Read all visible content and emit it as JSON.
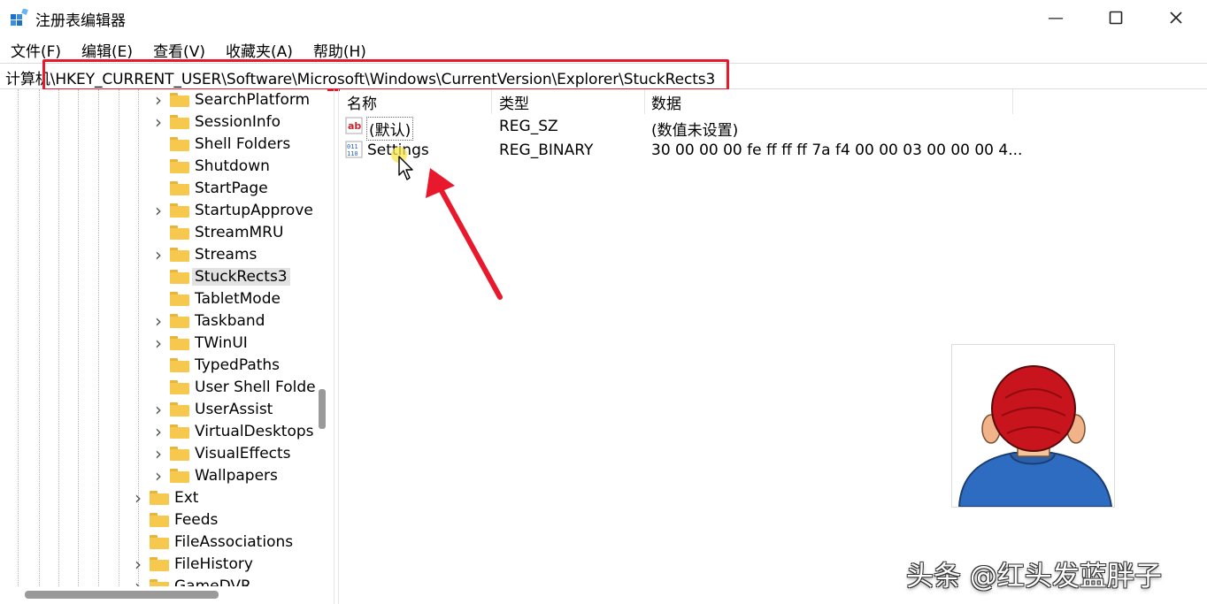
{
  "window": {
    "title": "注册表编辑器",
    "minimize_glyph": "—",
    "maximize_glyph": "☐",
    "close_glyph": "✕"
  },
  "menu": [
    "文件(F)",
    "编辑(E)",
    "查看(V)",
    "收藏夹(A)",
    "帮助(H)"
  ],
  "address": {
    "path": "计算机\\HKEY_CURRENT_USER\\Software\\Microsoft\\Windows\\CurrentVersion\\Explorer\\StuckRects3"
  },
  "tree": {
    "items": [
      {
        "label": "SearchPlatform",
        "expandable": true
      },
      {
        "label": "SessionInfo",
        "expandable": true
      },
      {
        "label": "Shell Folders",
        "expandable": false
      },
      {
        "label": "Shutdown",
        "expandable": false
      },
      {
        "label": "StartPage",
        "expandable": false
      },
      {
        "label": "StartupApprove",
        "expandable": true
      },
      {
        "label": "StreamMRU",
        "expandable": false
      },
      {
        "label": "Streams",
        "expandable": true
      },
      {
        "label": "StuckRects3",
        "expandable": false,
        "selected": true
      },
      {
        "label": "TabletMode",
        "expandable": false
      },
      {
        "label": "Taskband",
        "expandable": true
      },
      {
        "label": "TWinUI",
        "expandable": true
      },
      {
        "label": "TypedPaths",
        "expandable": false
      },
      {
        "label": "User Shell Folde",
        "expandable": false
      },
      {
        "label": "UserAssist",
        "expandable": true
      },
      {
        "label": "VirtualDesktops",
        "expandable": true
      },
      {
        "label": "VisualEffects",
        "expandable": true
      },
      {
        "label": "Wallpapers",
        "expandable": true
      },
      {
        "label": "Ext",
        "expandable": true
      },
      {
        "label": "Feeds",
        "expandable": false
      },
      {
        "label": "FileAssociations",
        "expandable": false
      },
      {
        "label": "FileHistory",
        "expandable": true
      },
      {
        "label": "GameDVR",
        "expandable": true
      }
    ]
  },
  "list": {
    "headers": {
      "name": "名称",
      "type": "类型",
      "data": "数据"
    },
    "rows": [
      {
        "name": "(默认)",
        "type": "REG_SZ",
        "data": "(数值未设置)",
        "icon": "string-value-icon"
      },
      {
        "name": "Settings",
        "type": "REG_BINARY",
        "data": "30 00 00 00 fe ff ff ff 7a f4 00 00 03 00 00 00 4...",
        "icon": "binary-value-icon"
      }
    ]
  },
  "annotation": {
    "highlight_color": "#e8192c",
    "arrow_color": "#e8192c"
  },
  "watermark": "头条 @红头发蓝胖子"
}
